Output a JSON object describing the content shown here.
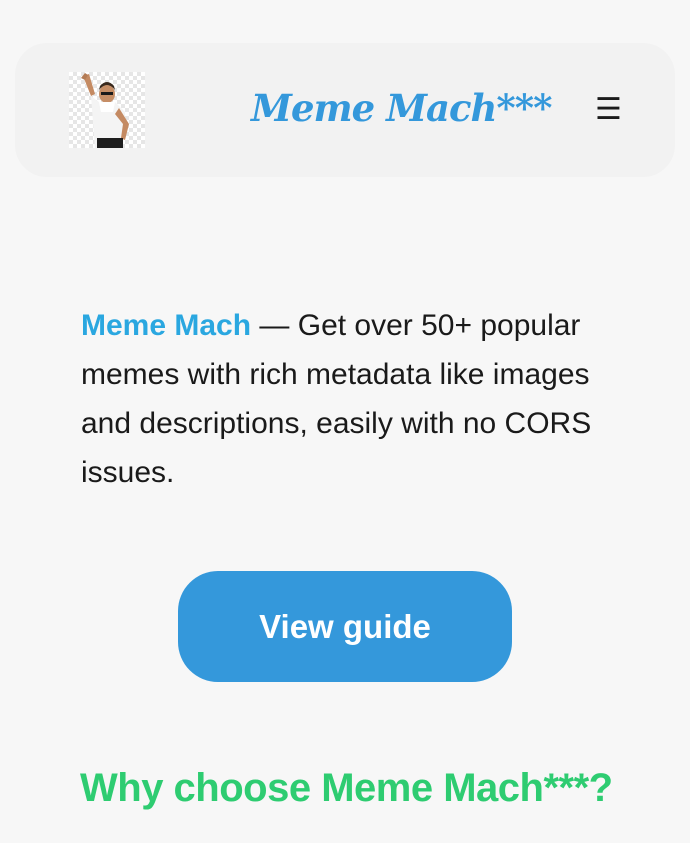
{
  "header": {
    "logo_icon": "meme-person-icon",
    "brand": "Meme Mach***",
    "menu_glyph": "☰",
    "menu_icon": "hamburger-menu-icon"
  },
  "intro": {
    "highlight": "Meme Mach",
    "text": " — Get over 50+ popular memes with rich metadata like images and descriptions, easily with no CORS issues."
  },
  "cta": {
    "label": "View guide"
  },
  "section": {
    "heading": "Why choose Meme Mach***?"
  },
  "colors": {
    "brand": "#3498db",
    "highlight": "#2aa7e0",
    "heading": "#2ecc71",
    "background": "#f7f7f7",
    "header_bg": "#f2f2f2"
  }
}
